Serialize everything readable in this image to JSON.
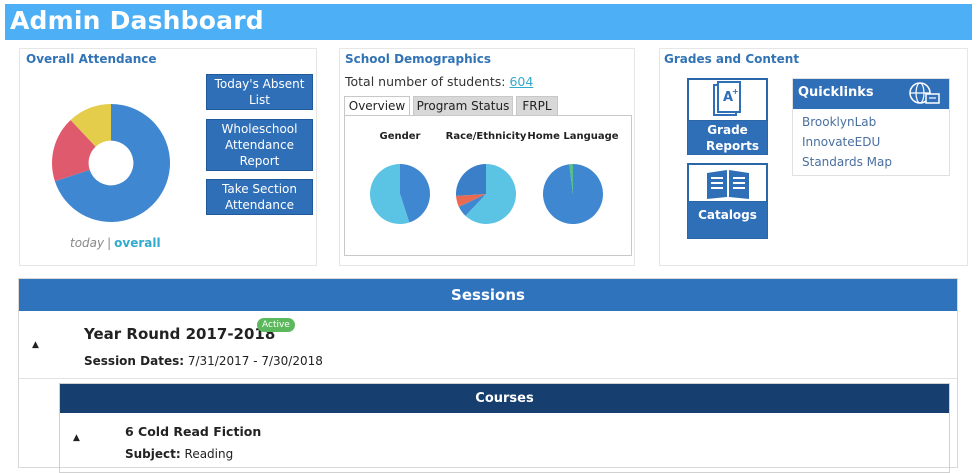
{
  "header": {
    "title": "Admin Dashboard"
  },
  "attendance": {
    "title": "Overall Attendance",
    "buttons": [
      "Today's Absent List",
      "Wholeschool Attendance Report",
      "Take Section Attendance"
    ],
    "toggle": {
      "today": "today",
      "separator": "|",
      "overall": "overall"
    },
    "donut": {
      "segments": [
        {
          "name": "blue",
          "value": 70,
          "color": "#3f87d0"
        },
        {
          "name": "pink",
          "value": 18,
          "color": "#e05a6d"
        },
        {
          "name": "yellow",
          "value": 12,
          "color": "#e4cd4a"
        }
      ]
    }
  },
  "demographics": {
    "title": "School Demographics",
    "total_label": "Total number of students:",
    "total_value": "604",
    "tabs": [
      "Overview",
      "Program Status",
      "FRPL"
    ],
    "pies": [
      {
        "label": "Gender",
        "slices": [
          {
            "value": 45,
            "color": "#3f87d0"
          },
          {
            "value": 55,
            "color": "#5bc4e4"
          }
        ]
      },
      {
        "label": "Race/Ethnicity",
        "slices": [
          {
            "value": 62,
            "color": "#5bc4e4"
          },
          {
            "value": 6,
            "color": "#3f87d0"
          },
          {
            "value": 6,
            "color": "#e86a52"
          },
          {
            "value": 26,
            "color": "#3a7fc8"
          }
        ]
      },
      {
        "label": "Home Language",
        "slices": [
          {
            "value": 98,
            "color": "#3f87d0"
          },
          {
            "value": 2,
            "color": "#52c08a"
          }
        ]
      }
    ]
  },
  "grades": {
    "title": "Grades and Content",
    "tiles": [
      "Grade Reports",
      "Catalogs"
    ],
    "quicklinks": {
      "title": "Quicklinks",
      "links": [
        "BrooklynLab",
        "InnovateEDU",
        "Standards Map"
      ]
    }
  },
  "sessions": {
    "title": "Sessions",
    "session_name": "Year Round 2017-2018",
    "badge": "Active",
    "dates_label": "Session Dates:",
    "dates_value": "7/31/2017 - 7/30/2018",
    "courses_title": "Courses",
    "course_name": "6 Cold Read Fiction",
    "subject_label": "Subject:",
    "subject_value": "Reading"
  }
}
